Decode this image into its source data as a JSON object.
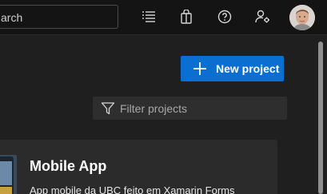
{
  "header": {
    "search_placeholder": "arch",
    "icons": [
      "task-list-icon",
      "shopping-bag-icon",
      "help-icon",
      "user-settings-icon"
    ],
    "avatar": "user-avatar"
  },
  "toolbar": {
    "new_project_label": "New project",
    "new_project_icon": "plus-icon",
    "accent_color": "#0a6fd1"
  },
  "filter": {
    "placeholder": "Filter projects",
    "icon": "funnel-icon"
  },
  "projects": [
    {
      "title": "Mobile App",
      "description": "App mobile da UBC feito em Xamarin Forms"
    }
  ]
}
